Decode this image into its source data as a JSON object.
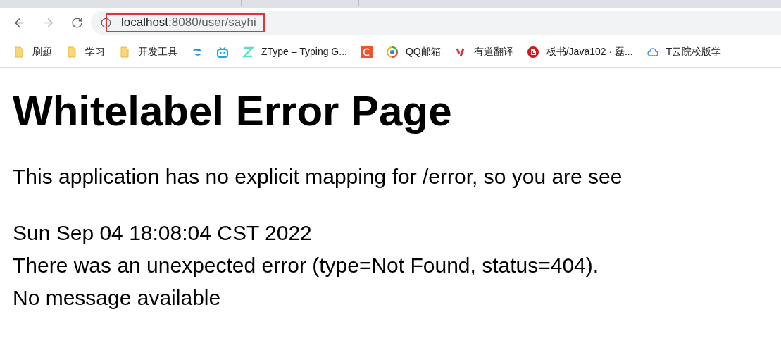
{
  "address_bar": {
    "host": "localhost",
    "path": ":8080/user/sayhi"
  },
  "bookmarks": [
    {
      "kind": "folder",
      "label": "刷题"
    },
    {
      "kind": "folder",
      "label": "学习"
    },
    {
      "kind": "folder",
      "label": "开发工具"
    },
    {
      "kind": "leaf"
    },
    {
      "kind": "tv"
    },
    {
      "kind": "z",
      "label": "ZType – Typing G..."
    },
    {
      "kind": "c"
    },
    {
      "kind": "qq",
      "label": "QQ邮箱"
    },
    {
      "kind": "y",
      "label": "有道翻译"
    },
    {
      "kind": "g",
      "label": "板书/Java102 · 磊..."
    },
    {
      "kind": "cloud",
      "label": "T云院校版学"
    }
  ],
  "page": {
    "heading": "Whitelabel Error Page",
    "message": "This application has no explicit mapping for /error, so you are see",
    "lines": [
      "Sun Sep 04 18:08:04 CST 2022",
      "There was an unexpected error (type=Not Found, status=404).",
      "No message available"
    ]
  }
}
